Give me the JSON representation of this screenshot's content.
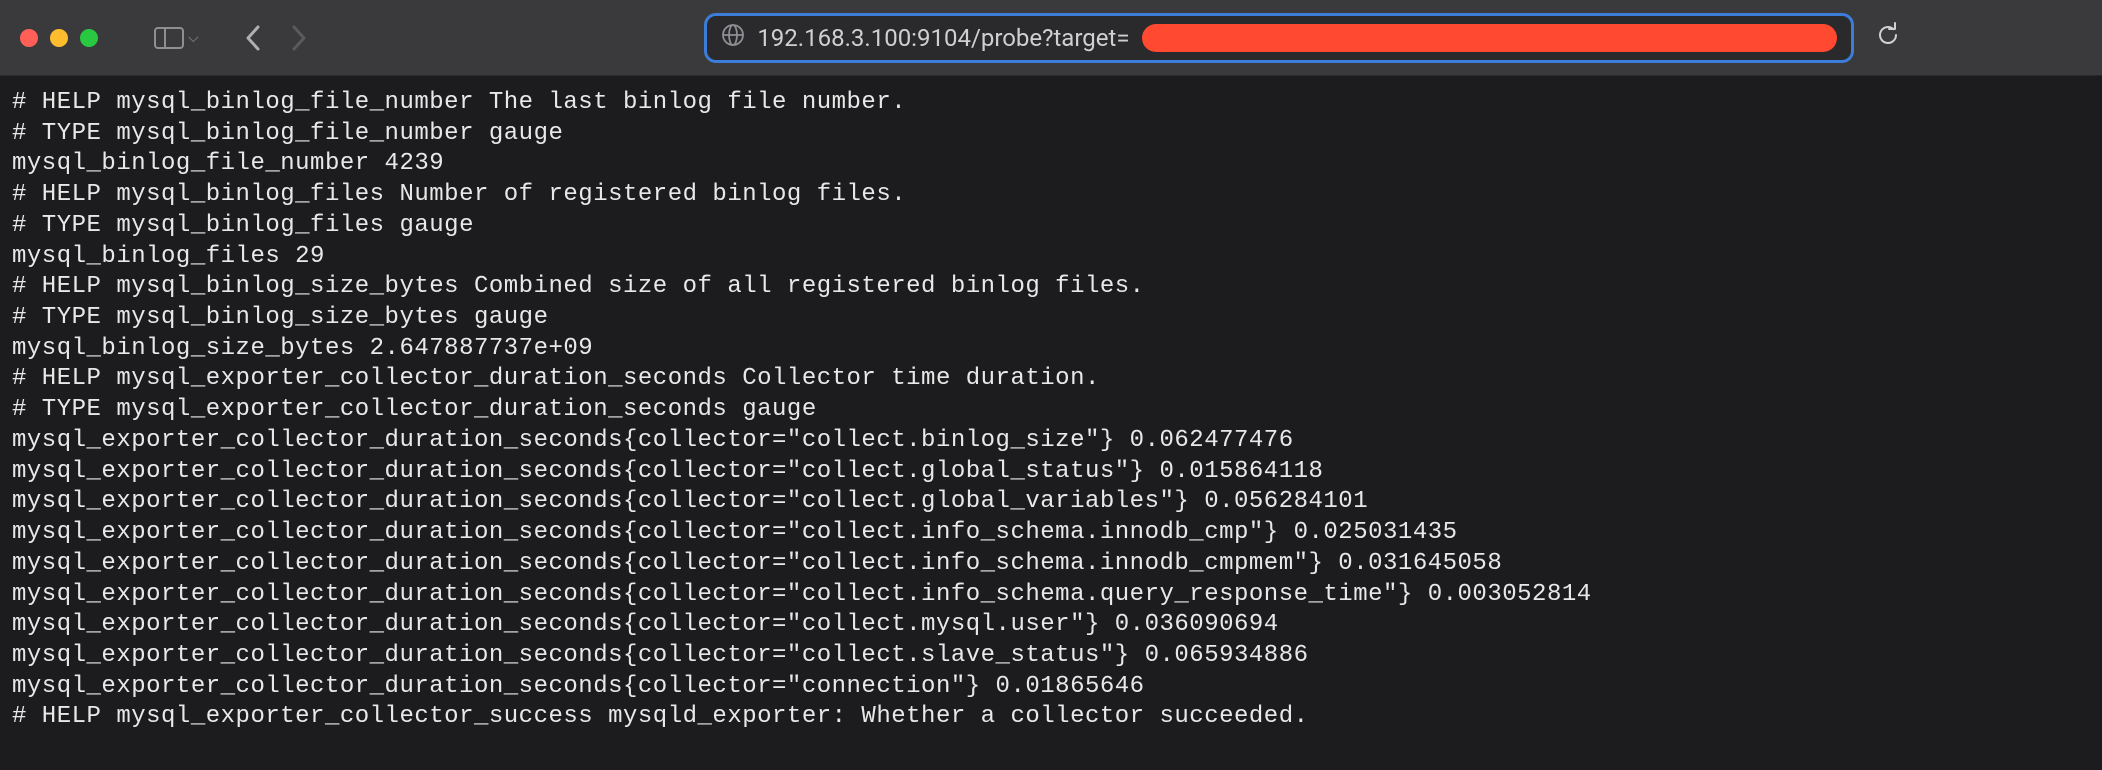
{
  "toolbar": {
    "url": "192.168.3.100:9104/probe?target="
  },
  "metrics": {
    "lines": [
      "# HELP mysql_binlog_file_number The last binlog file number.",
      "# TYPE mysql_binlog_file_number gauge",
      "mysql_binlog_file_number 4239",
      "# HELP mysql_binlog_files Number of registered binlog files.",
      "# TYPE mysql_binlog_files gauge",
      "mysql_binlog_files 29",
      "# HELP mysql_binlog_size_bytes Combined size of all registered binlog files.",
      "# TYPE mysql_binlog_size_bytes gauge",
      "mysql_binlog_size_bytes 2.647887737e+09",
      "# HELP mysql_exporter_collector_duration_seconds Collector time duration.",
      "# TYPE mysql_exporter_collector_duration_seconds gauge",
      "mysql_exporter_collector_duration_seconds{collector=\"collect.binlog_size\"} 0.062477476",
      "mysql_exporter_collector_duration_seconds{collector=\"collect.global_status\"} 0.015864118",
      "mysql_exporter_collector_duration_seconds{collector=\"collect.global_variables\"} 0.056284101",
      "mysql_exporter_collector_duration_seconds{collector=\"collect.info_schema.innodb_cmp\"} 0.025031435",
      "mysql_exporter_collector_duration_seconds{collector=\"collect.info_schema.innodb_cmpmem\"} 0.031645058",
      "mysql_exporter_collector_duration_seconds{collector=\"collect.info_schema.query_response_time\"} 0.003052814",
      "mysql_exporter_collector_duration_seconds{collector=\"collect.mysql.user\"} 0.036090694",
      "mysql_exporter_collector_duration_seconds{collector=\"collect.slave_status\"} 0.065934886",
      "mysql_exporter_collector_duration_seconds{collector=\"connection\"} 0.01865646",
      "# HELP mysql_exporter_collector_success mysqld_exporter: Whether a collector succeeded."
    ]
  }
}
